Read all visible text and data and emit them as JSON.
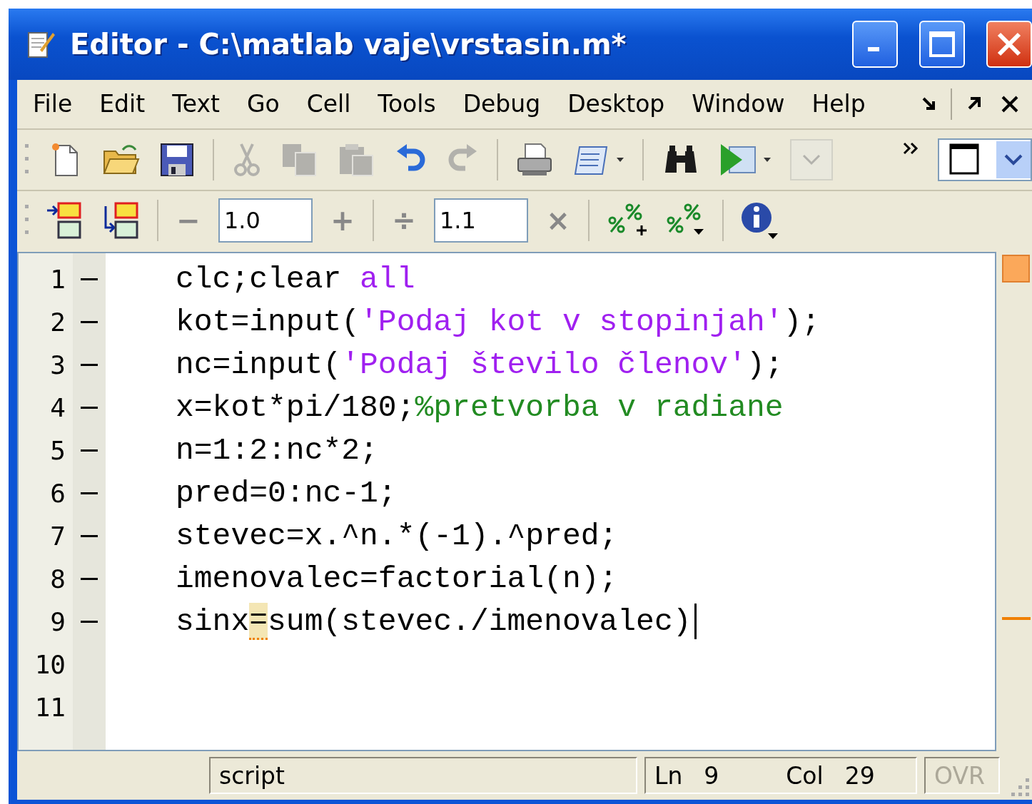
{
  "window": {
    "title": "Editor - C:\\matlab vaje\\vrstasin.m*"
  },
  "menu": [
    "File",
    "Edit",
    "Text",
    "Go",
    "Cell",
    "Tools",
    "Debug",
    "Desktop",
    "Window",
    "Help"
  ],
  "toolbar": [
    {
      "kind": "new",
      "disabled": false
    },
    {
      "kind": "open",
      "disabled": false
    },
    {
      "kind": "save",
      "disabled": false
    },
    {
      "kind": "sep"
    },
    {
      "kind": "cut",
      "disabled": true
    },
    {
      "kind": "copy",
      "disabled": true
    },
    {
      "kind": "paste",
      "disabled": true
    },
    {
      "kind": "undo",
      "disabled": false
    },
    {
      "kind": "redo",
      "disabled": true
    },
    {
      "kind": "sep"
    },
    {
      "kind": "print",
      "disabled": false
    },
    {
      "kind": "page",
      "disabled": false
    },
    {
      "kind": "caret",
      "disabled": false
    },
    {
      "kind": "sep"
    },
    {
      "kind": "find",
      "disabled": false
    },
    {
      "kind": "run",
      "disabled": false
    },
    {
      "kind": "caret",
      "disabled": false
    },
    {
      "kind": "stack",
      "disabled": true
    }
  ],
  "cell_toolbar": {
    "decrement": "−",
    "value_1": "1.0",
    "increment": "+",
    "divide": "÷",
    "value_2": "1.1",
    "multiply": "×"
  },
  "editor": {
    "lines": [
      {
        "number": "1",
        "executable": true,
        "cursor": false,
        "tokens": [
          {
            "kind": "code",
            "text": "clc;clear "
          },
          {
            "kind": "keyword",
            "text": "all"
          }
        ]
      },
      {
        "number": "2",
        "executable": true,
        "cursor": false,
        "tokens": [
          {
            "kind": "code",
            "text": "kot=input("
          },
          {
            "kind": "string",
            "text": "'Podaj kot v stopinjah'"
          },
          {
            "kind": "code",
            "text": ");"
          }
        ]
      },
      {
        "number": "3",
        "executable": true,
        "cursor": false,
        "tokens": [
          {
            "kind": "code",
            "text": "nc=input("
          },
          {
            "kind": "string",
            "text": "'Podaj število členov'"
          },
          {
            "kind": "code",
            "text": ");"
          }
        ]
      },
      {
        "number": "4",
        "executable": true,
        "cursor": false,
        "tokens": [
          {
            "kind": "code",
            "text": "x=kot*pi/180;"
          },
          {
            "kind": "comment",
            "text": "%pretvorba v radiane"
          }
        ]
      },
      {
        "number": "5",
        "executable": true,
        "cursor": false,
        "tokens": [
          {
            "kind": "code",
            "text": "n=1:2:nc*2;"
          }
        ]
      },
      {
        "number": "6",
        "executable": true,
        "cursor": false,
        "tokens": [
          {
            "kind": "code",
            "text": "pred=0:nc-1;"
          }
        ]
      },
      {
        "number": "7",
        "executable": true,
        "cursor": false,
        "tokens": [
          {
            "kind": "code",
            "text": "stevec=x.^n.*(-1).^pred;"
          }
        ]
      },
      {
        "number": "8",
        "executable": true,
        "cursor": false,
        "tokens": [
          {
            "kind": "code",
            "text": "imenovalec=factorial(n);"
          }
        ]
      },
      {
        "number": "9",
        "executable": true,
        "cursor": true,
        "tokens": [
          {
            "kind": "code",
            "text": "sinx"
          },
          {
            "kind": "warning",
            "text": "="
          },
          {
            "kind": "code",
            "text": "sum(stevec./imenovalec)"
          }
        ]
      },
      {
        "number": "10",
        "executable": false,
        "cursor": false
      },
      {
        "number": "11",
        "executable": false,
        "cursor": false
      }
    ]
  },
  "status_bar": {
    "mode": "script",
    "ln_label": "Ln",
    "ln": "9",
    "col_label": "Col",
    "col": "29",
    "ovr": "OVR",
    "ovr_enabled": false
  }
}
